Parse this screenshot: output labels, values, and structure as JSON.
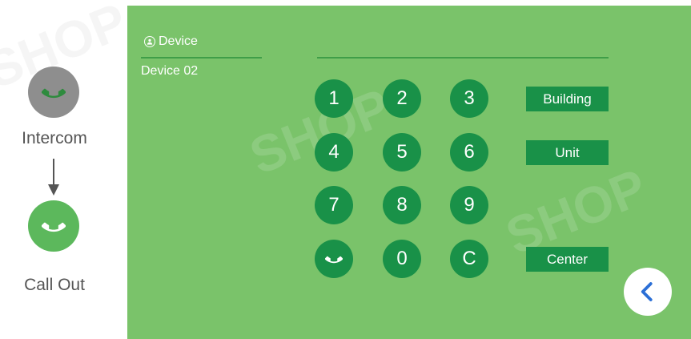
{
  "sidebar": {
    "intercom_label": "Intercom",
    "callout_label": "Call Out",
    "intercom_icon": "phone-handset-icon",
    "callout_icon": "phone-handset-icon",
    "intercom_color": "#8e8e8e",
    "callout_color": "#5cb85c"
  },
  "device": {
    "title": "Device",
    "title_icon": "user-icon",
    "selected": "Device 02"
  },
  "dial_input": {
    "value": ""
  },
  "keypad": {
    "k1": "1",
    "k2": "2",
    "k3": "3",
    "k4": "4",
    "k5": "5",
    "k6": "6",
    "k7": "7",
    "k8": "8",
    "k9": "9",
    "call_icon": "phone-handset-icon",
    "k0": "0",
    "clear": "C"
  },
  "targets": {
    "building": "Building",
    "unit": "Unit",
    "center": "Center"
  },
  "back_icon": "chevron-left-icon",
  "colors": {
    "panel_bg": "#7ac36a",
    "key_bg": "#199148",
    "line": "#3f9e48",
    "back_chevron": "#2b6fd6"
  }
}
